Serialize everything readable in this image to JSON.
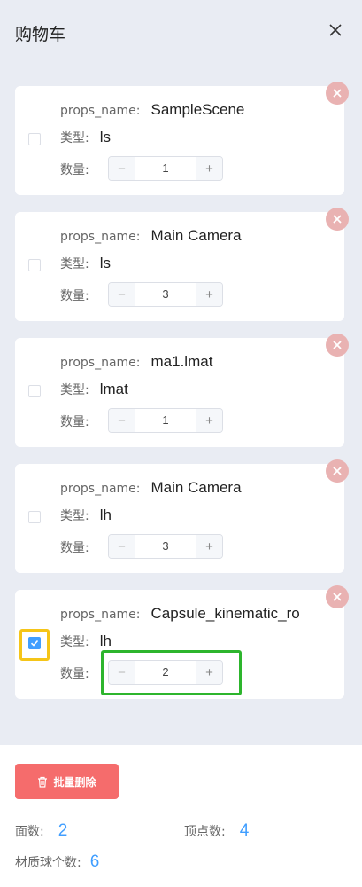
{
  "header": {
    "title": "购物车"
  },
  "labels": {
    "props_name": "props_name:",
    "type": "类型:",
    "quantity": "数量:"
  },
  "stepper": {
    "minus": "−",
    "plus": "+"
  },
  "items": [
    {
      "props_name": "SampleScene",
      "type": "ls",
      "quantity": "1",
      "checked": false
    },
    {
      "props_name": "Main Camera",
      "type": "ls",
      "quantity": "3",
      "checked": false
    },
    {
      "props_name": "ma1.lmat",
      "type": "lmat",
      "quantity": "1",
      "checked": false
    },
    {
      "props_name": "Main Camera",
      "type": "lh",
      "quantity": "3",
      "checked": false
    },
    {
      "props_name": "Capsule_kinematic_ro",
      "type": "lh",
      "quantity": "2",
      "checked": true
    }
  ],
  "footer": {
    "batch_delete_label": "批量删除",
    "faces_label": "面数:",
    "faces_value": "2",
    "vertices_label": "顶点数:",
    "vertices_value": "4",
    "materials_label": "材质球个数:",
    "materials_value": "6"
  },
  "colors": {
    "accent": "#409eff",
    "danger": "#f56c6c",
    "highlight_checkbox": "#f5c518",
    "highlight_stepper": "#2db52d"
  }
}
